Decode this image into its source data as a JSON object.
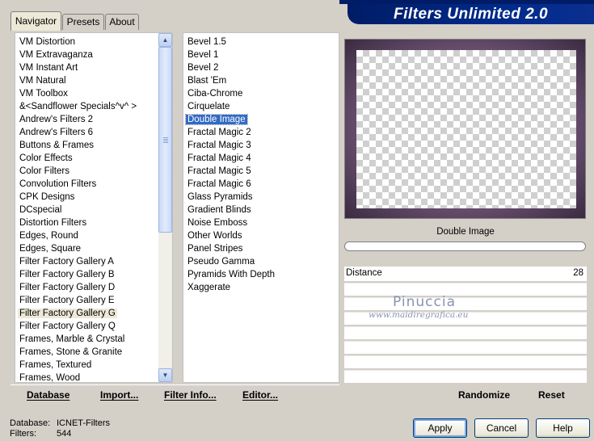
{
  "window": {
    "banner_title": "Filters Unlimited 2.0"
  },
  "tabs": [
    {
      "label": "Navigator"
    },
    {
      "label": "Presets"
    },
    {
      "label": "About"
    }
  ],
  "categories": {
    "items": [
      "VM Distortion",
      "VM Extravaganza",
      "VM Instant Art",
      "VM Natural",
      "VM Toolbox",
      "&<Sandflower Specials^v^ >",
      "Andrew's Filters 2",
      "Andrew's Filters 6",
      "Buttons & Frames",
      "Color Effects",
      "Color Filters",
      "Convolution Filters",
      "CPK Designs",
      "DCspecial",
      "Distortion Filters",
      "Edges, Round",
      "Edges, Square",
      "Filter Factory Gallery A",
      "Filter Factory Gallery B",
      "Filter Factory Gallery D",
      "Filter Factory Gallery E",
      "Filter Factory Gallery G",
      "Filter Factory Gallery Q",
      "Frames, Marble & Crystal",
      "Frames, Stone & Granite",
      "Frames, Textured",
      "Frames, Wood"
    ],
    "highlighted": "Filter Factory Gallery G"
  },
  "filters": {
    "items": [
      "Bevel 1.5",
      "Bevel 1",
      "Bevel 2",
      "Blast 'Em",
      "Ciba-Chrome",
      "Cirquelate",
      "Double Image",
      "Fractal Magic 2",
      "Fractal Magic 3",
      "Fractal Magic 4",
      "Fractal Magic 5",
      "Fractal Magic 6",
      "Glass Pyramids",
      "Gradient Blinds",
      "Noise Emboss",
      "Other Worlds",
      "Panel Stripes",
      "Pseudo Gamma",
      "Pyramids With Depth",
      "Xaggerate"
    ],
    "selected": "Double Image"
  },
  "preview": {
    "filter_name": "Double Image"
  },
  "parameters": [
    {
      "label": "Distance",
      "value": "28"
    }
  ],
  "watermark": {
    "line1": "Pinuccia",
    "line2": "www.maidiregrafica.eu"
  },
  "toolbar": {
    "database": "Database",
    "import": "Import...",
    "filter_info": "Filter Info...",
    "editor": "Editor...",
    "randomize": "Randomize",
    "reset": "Reset"
  },
  "status": {
    "database_label": "Database:",
    "database_value": "ICNET-Filters",
    "filters_label": "Filters:",
    "filters_value": "544"
  },
  "dialog": {
    "apply": "Apply",
    "cancel": "Cancel",
    "help": "Help"
  },
  "colors": {
    "banner": "#002a8a",
    "selection": "#316ac5"
  }
}
